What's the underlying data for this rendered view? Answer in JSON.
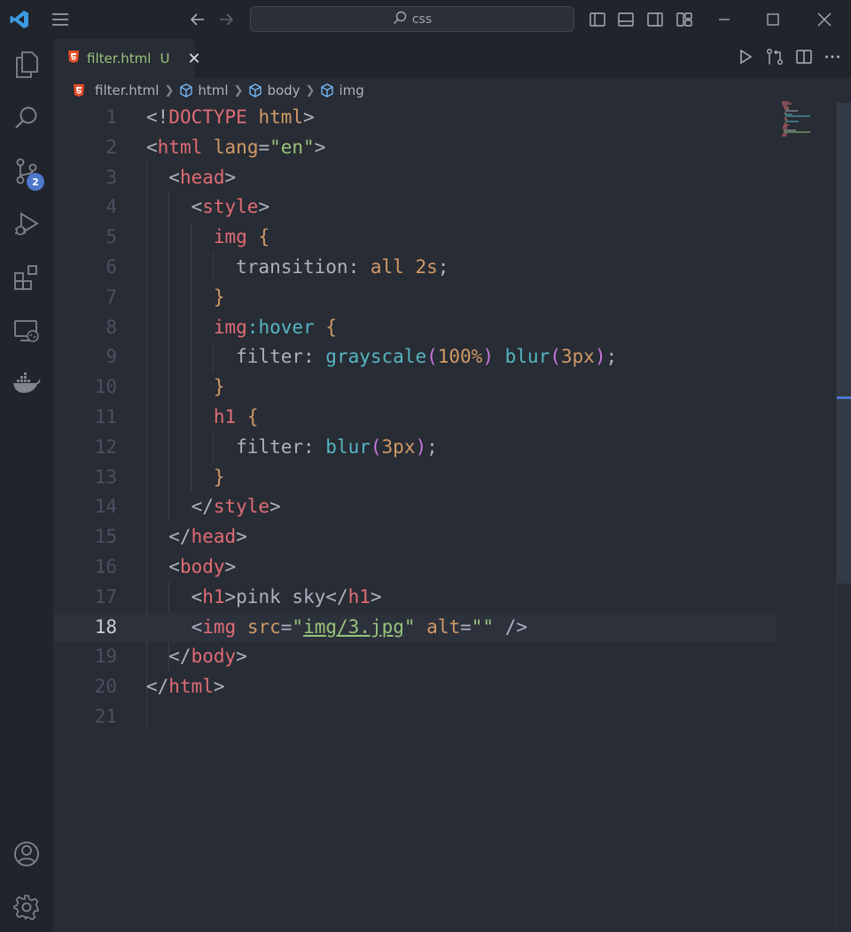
{
  "titlebar": {
    "search_text": "css"
  },
  "activity": {
    "scm_badge": "2"
  },
  "tab": {
    "file_name": "filter.html",
    "status": "U",
    "close": "✕"
  },
  "breadcrumb": {
    "file": "filter.html",
    "items": [
      "html",
      "body",
      "img"
    ]
  },
  "editor": {
    "active_line": 18,
    "line_numbers": [
      "1",
      "2",
      "3",
      "4",
      "5",
      "6",
      "7",
      "8",
      "9",
      "10",
      "11",
      "12",
      "13",
      "14",
      "15",
      "16",
      "17",
      "18",
      "19",
      "20",
      "21"
    ],
    "lines": [
      [
        [
          "p",
          "<!"
        ],
        [
          "t",
          "DOCTYPE"
        ],
        [
          "p",
          " "
        ],
        [
          "a",
          "html"
        ],
        [
          "p",
          ">"
        ]
      ],
      [
        [
          "p",
          "<"
        ],
        [
          "t",
          "html"
        ],
        [
          "p",
          " "
        ],
        [
          "a",
          "lang"
        ],
        [
          "p",
          "="
        ],
        [
          "s",
          "\"en\""
        ],
        [
          "p",
          ">"
        ]
      ],
      [
        [
          "p",
          "  <"
        ],
        [
          "t",
          "head"
        ],
        [
          "p",
          ">"
        ]
      ],
      [
        [
          "p",
          "    <"
        ],
        [
          "t",
          "style"
        ],
        [
          "p",
          ">"
        ]
      ],
      [
        [
          "p",
          "      "
        ],
        [
          "sel",
          "img"
        ],
        [
          "p",
          " "
        ],
        [
          "b1",
          "{"
        ]
      ],
      [
        [
          "p",
          "        transition: "
        ],
        [
          "n",
          "all"
        ],
        [
          "p",
          " "
        ],
        [
          "n",
          "2s"
        ],
        [
          "p",
          ";"
        ]
      ],
      [
        [
          "p",
          "      "
        ],
        [
          "b1",
          "}"
        ]
      ],
      [
        [
          "p",
          "      "
        ],
        [
          "sel",
          "img"
        ],
        [
          "cls",
          ":hover"
        ],
        [
          "p",
          " "
        ],
        [
          "b1",
          "{"
        ]
      ],
      [
        [
          "p",
          "        filter: "
        ],
        [
          "f",
          "grayscale"
        ],
        [
          "b2",
          "("
        ],
        [
          "n",
          "100%"
        ],
        [
          "b2",
          ")"
        ],
        [
          "p",
          " "
        ],
        [
          "f",
          "blur"
        ],
        [
          "b2",
          "("
        ],
        [
          "n",
          "3px"
        ],
        [
          "b2",
          ")"
        ],
        [
          "p",
          ";"
        ]
      ],
      [
        [
          "p",
          "      "
        ],
        [
          "b1",
          "}"
        ]
      ],
      [
        [
          "p",
          "      "
        ],
        [
          "sel",
          "h1"
        ],
        [
          "p",
          " "
        ],
        [
          "b1",
          "{"
        ]
      ],
      [
        [
          "p",
          "        filter: "
        ],
        [
          "f",
          "blur"
        ],
        [
          "b2",
          "("
        ],
        [
          "n",
          "3px"
        ],
        [
          "b2",
          ")"
        ],
        [
          "p",
          ";"
        ]
      ],
      [
        [
          "p",
          "      "
        ],
        [
          "b1",
          "}"
        ]
      ],
      [
        [
          "p",
          "    </"
        ],
        [
          "t",
          "style"
        ],
        [
          "p",
          ">"
        ]
      ],
      [
        [
          "p",
          "  </"
        ],
        [
          "t",
          "head"
        ],
        [
          "p",
          ">"
        ]
      ],
      [
        [
          "p",
          "  <"
        ],
        [
          "t",
          "body"
        ],
        [
          "p",
          ">"
        ]
      ],
      [
        [
          "p",
          "    <"
        ],
        [
          "t",
          "h1"
        ],
        [
          "p",
          ">pink sky</"
        ],
        [
          "t",
          "h1"
        ],
        [
          "p",
          ">"
        ]
      ],
      [
        [
          "p",
          "    <"
        ],
        [
          "t",
          "img"
        ],
        [
          "p",
          " "
        ],
        [
          "a",
          "src"
        ],
        [
          "p",
          "="
        ],
        [
          "s",
          "\""
        ],
        [
          "su",
          "img/3.jpg"
        ],
        [
          "s",
          "\""
        ],
        [
          "p",
          " "
        ],
        [
          "a",
          "alt"
        ],
        [
          "p",
          "="
        ],
        [
          "s",
          "\"\""
        ],
        [
          "p",
          " />"
        ]
      ],
      [
        [
          "p",
          "  </"
        ],
        [
          "t",
          "body"
        ],
        [
          "p",
          ">"
        ]
      ],
      [
        [
          "p",
          "</"
        ],
        [
          "t",
          "html"
        ],
        [
          "p",
          ">"
        ]
      ],
      []
    ]
  }
}
